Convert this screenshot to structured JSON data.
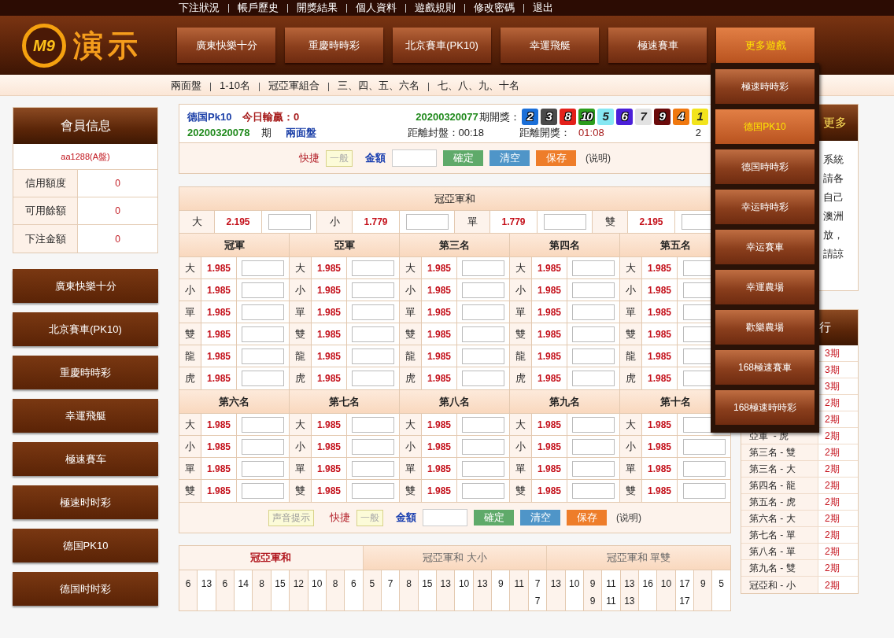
{
  "top_links": [
    "下注狀況",
    "帳戶歷史",
    "開獎結果",
    "個人資料",
    "遊戲規則",
    "修改密碼",
    "退出"
  ],
  "logo": {
    "badge": "M9",
    "title": "演示"
  },
  "nav": [
    {
      "label": "廣東快樂十分",
      "selected": false
    },
    {
      "label": "重慶時時彩",
      "selected": false
    },
    {
      "label": "北京賽車(PK10)",
      "selected": false
    },
    {
      "label": "幸運飛艇",
      "selected": false
    },
    {
      "label": "極速賽車",
      "selected": false
    },
    {
      "label": "更多遊戲",
      "selected": true
    }
  ],
  "sub_nav": [
    "兩面盤",
    "1-10名",
    "冠亞軍組合",
    "三、四、五、六名",
    "七、八、九、十名"
  ],
  "member": {
    "title": "會員信息",
    "account": "aa1288(A盤)",
    "rows": [
      {
        "label": "信用額度",
        "value": "0"
      },
      {
        "label": "可用餘額",
        "value": "0"
      },
      {
        "label": "下注金額",
        "value": "0"
      }
    ]
  },
  "games": [
    "廣東快樂十分",
    "北京賽車(PK10)",
    "重慶時時彩",
    "幸運飛艇",
    "極速賽车",
    "極速时时彩",
    "德国PK10",
    "德国时时彩"
  ],
  "draw_info": {
    "game": "德国Pk10",
    "today_label": "今日輸贏：",
    "today_value": "0",
    "last_period": "20200320077",
    "last_label": "期開獎：",
    "balls": [
      {
        "number": "2",
        "color": "#1b6fd8"
      },
      {
        "number": "3",
        "color": "#4a4a4a"
      },
      {
        "number": "8",
        "color": "#e3211b"
      },
      {
        "number": "10",
        "color": "#2c9c1c"
      },
      {
        "number": "5",
        "color": "#86e7f2"
      },
      {
        "number": "6",
        "color": "#4b1fd8"
      },
      {
        "number": "7",
        "color": "#e2e2e2"
      },
      {
        "number": "9",
        "color": "#6a0b0b"
      },
      {
        "number": "4",
        "color": "#f0780f"
      },
      {
        "number": "1",
        "color": "#f2e41c"
      }
    ],
    "current_period": "20200320078",
    "period_label": "期",
    "mode": "兩面盤",
    "close_label": "距離封盤：",
    "close_time": "00:18",
    "open_label": "距離開獎：",
    "open_time": "01:08",
    "refresh": "2"
  },
  "quick_bars": [
    {
      "shortcut_label": "快捷",
      "mode": "一般",
      "amount_label": "金額",
      "buttons": [
        {
          "label": "確定",
          "kind": "confirm"
        },
        {
          "label": "清空",
          "kind": "clear"
        },
        {
          "label": "保存",
          "kind": "save"
        }
      ],
      "help": "(说明)"
    },
    {
      "sound_label": "声音提示",
      "shortcut_label": "快捷",
      "mode": "一般",
      "amount_label": "金額",
      "buttons": [
        {
          "label": "確定",
          "kind": "confirm"
        },
        {
          "label": "清空",
          "kind": "clear"
        },
        {
          "label": "保存",
          "kind": "save"
        }
      ],
      "help": "(说明)"
    }
  ],
  "sum_table": {
    "title": "冠亞軍和",
    "items": [
      {
        "label": "大",
        "odds": "2.195"
      },
      {
        "label": "小",
        "odds": "1.779"
      },
      {
        "label": "單",
        "odds": "1.779"
      },
      {
        "label": "雙",
        "odds": "2.195"
      }
    ]
  },
  "rank_groups": [
    [
      {
        "title": "冠軍",
        "rows": [
          {
            "label": "大",
            "odds": "1.985"
          },
          {
            "label": "小",
            "odds": "1.985"
          },
          {
            "label": "單",
            "odds": "1.985"
          },
          {
            "label": "雙",
            "odds": "1.985"
          },
          {
            "label": "龍",
            "odds": "1.985"
          },
          {
            "label": "虎",
            "odds": "1.985"
          }
        ]
      },
      {
        "title": "亞軍",
        "rows": [
          {
            "label": "大",
            "odds": "1.985"
          },
          {
            "label": "小",
            "odds": "1.985"
          },
          {
            "label": "單",
            "odds": "1.985"
          },
          {
            "label": "雙",
            "odds": "1.985"
          },
          {
            "label": "龍",
            "odds": "1.985"
          },
          {
            "label": "虎",
            "odds": "1.985"
          }
        ]
      },
      {
        "title": "第三名",
        "rows": [
          {
            "label": "大",
            "odds": "1.985"
          },
          {
            "label": "小",
            "odds": "1.985"
          },
          {
            "label": "單",
            "odds": "1.985"
          },
          {
            "label": "雙",
            "odds": "1.985"
          },
          {
            "label": "龍",
            "odds": "1.985"
          },
          {
            "label": "虎",
            "odds": "1.985"
          }
        ]
      },
      {
        "title": "第四名",
        "rows": [
          {
            "label": "大",
            "odds": "1.985"
          },
          {
            "label": "小",
            "odds": "1.985"
          },
          {
            "label": "單",
            "odds": "1.985"
          },
          {
            "label": "雙",
            "odds": "1.985"
          },
          {
            "label": "龍",
            "odds": "1.985"
          },
          {
            "label": "虎",
            "odds": "1.985"
          }
        ]
      },
      {
        "title": "第五名",
        "rows": [
          {
            "label": "大",
            "odds": "1.985"
          },
          {
            "label": "小",
            "odds": "1.985"
          },
          {
            "label": "單",
            "odds": "1.985"
          },
          {
            "label": "雙",
            "odds": "1.985"
          },
          {
            "label": "龍",
            "odds": "1.985"
          },
          {
            "label": "虎",
            "odds": "1.985"
          }
        ]
      }
    ],
    [
      {
        "title": "第六名",
        "rows": [
          {
            "label": "大",
            "odds": "1.985"
          },
          {
            "label": "小",
            "odds": "1.985"
          },
          {
            "label": "單",
            "odds": "1.985"
          },
          {
            "label": "雙",
            "odds": "1.985"
          }
        ]
      },
      {
        "title": "第七名",
        "rows": [
          {
            "label": "大",
            "odds": "1.985"
          },
          {
            "label": "小",
            "odds": "1.985"
          },
          {
            "label": "單",
            "odds": "1.985"
          },
          {
            "label": "雙",
            "odds": "1.985"
          }
        ]
      },
      {
        "title": "第八名",
        "rows": [
          {
            "label": "大",
            "odds": "1.985"
          },
          {
            "label": "小",
            "odds": "1.985"
          },
          {
            "label": "單",
            "odds": "1.985"
          },
          {
            "label": "雙",
            "odds": "1.985"
          }
        ]
      },
      {
        "title": "第九名",
        "rows": [
          {
            "label": "大",
            "odds": "1.985"
          },
          {
            "label": "小",
            "odds": "1.985"
          },
          {
            "label": "單",
            "odds": "1.985"
          },
          {
            "label": "雙",
            "odds": "1.985"
          }
        ]
      },
      {
        "title": "第十名",
        "rows": [
          {
            "label": "大",
            "odds": "1.985"
          },
          {
            "label": "小",
            "odds": "1.985"
          },
          {
            "label": "單",
            "odds": "1.985"
          },
          {
            "label": "雙",
            "odds": "1.985"
          }
        ]
      }
    ]
  ],
  "stats": {
    "tabs": [
      {
        "label": "冠亞軍和",
        "selected": true
      },
      {
        "label": "冠亞軍和 大小",
        "selected": false
      },
      {
        "label": "冠亞軍和 單雙",
        "selected": false
      }
    ],
    "cells": [
      [
        "6"
      ],
      [
        "13"
      ],
      [
        "6"
      ],
      [
        "14"
      ],
      [
        "8"
      ],
      [
        "15"
      ],
      [
        "12"
      ],
      [
        "10"
      ],
      [
        "8"
      ],
      [
        "6"
      ],
      [
        "5"
      ],
      [
        "7"
      ],
      [
        "8"
      ],
      [
        "15"
      ],
      [
        "13"
      ],
      [
        "10"
      ],
      [
        "13"
      ],
      [
        "9"
      ],
      [
        "11"
      ],
      [
        "7",
        "7"
      ],
      [
        "13"
      ],
      [
        "10"
      ],
      [
        "9",
        "9"
      ],
      [
        "11",
        "11"
      ],
      [
        "13",
        "13"
      ],
      [
        "16"
      ],
      [
        "10"
      ],
      [
        "17",
        "17"
      ],
      [
        "9"
      ],
      [
        "5"
      ]
    ]
  },
  "notice": {
    "title": "更多",
    "lines": [
      "系統",
      "請各",
      "自己",
      "澳洲",
      "放，",
      "請諒"
    ]
  },
  "ranking": {
    "title": "行",
    "rows": [
      {
        "periods": "3期"
      },
      {
        "periods": "3期"
      },
      {
        "periods": "3期"
      },
      {
        "periods": "2期"
      },
      {
        "periods": "2期"
      },
      {
        "label": "亞軍  - 虎",
        "periods": "2期"
      },
      {
        "label": "第三名 - 雙",
        "periods": "2期"
      },
      {
        "label": "第三名 - 大",
        "periods": "2期"
      },
      {
        "label": "第四名 - 龍",
        "periods": "2期"
      },
      {
        "label": "第五名 - 虎",
        "periods": "2期"
      },
      {
        "label": "第六名 - 大",
        "periods": "2期"
      },
      {
        "label": "第七名 - 單",
        "periods": "2期"
      },
      {
        "label": "第八名 - 單",
        "periods": "2期"
      },
      {
        "label": "第九名 - 雙",
        "periods": "2期"
      },
      {
        "label": "冠亞和 - 小",
        "periods": "2期"
      }
    ]
  },
  "dropdown": [
    {
      "label": "極速時時彩",
      "selected": false
    },
    {
      "label": "德国PK10",
      "selected": true
    },
    {
      "label": "德国時時彩",
      "selected": false
    },
    {
      "label": "幸运時時彩",
      "selected": false
    },
    {
      "label": "幸运賽車",
      "selected": false
    },
    {
      "label": "幸運農場",
      "selected": false
    },
    {
      "label": "歡樂農場",
      "selected": false
    },
    {
      "label": "168極速賽車",
      "selected": false
    },
    {
      "label": "168極速時時彩",
      "selected": false
    }
  ]
}
